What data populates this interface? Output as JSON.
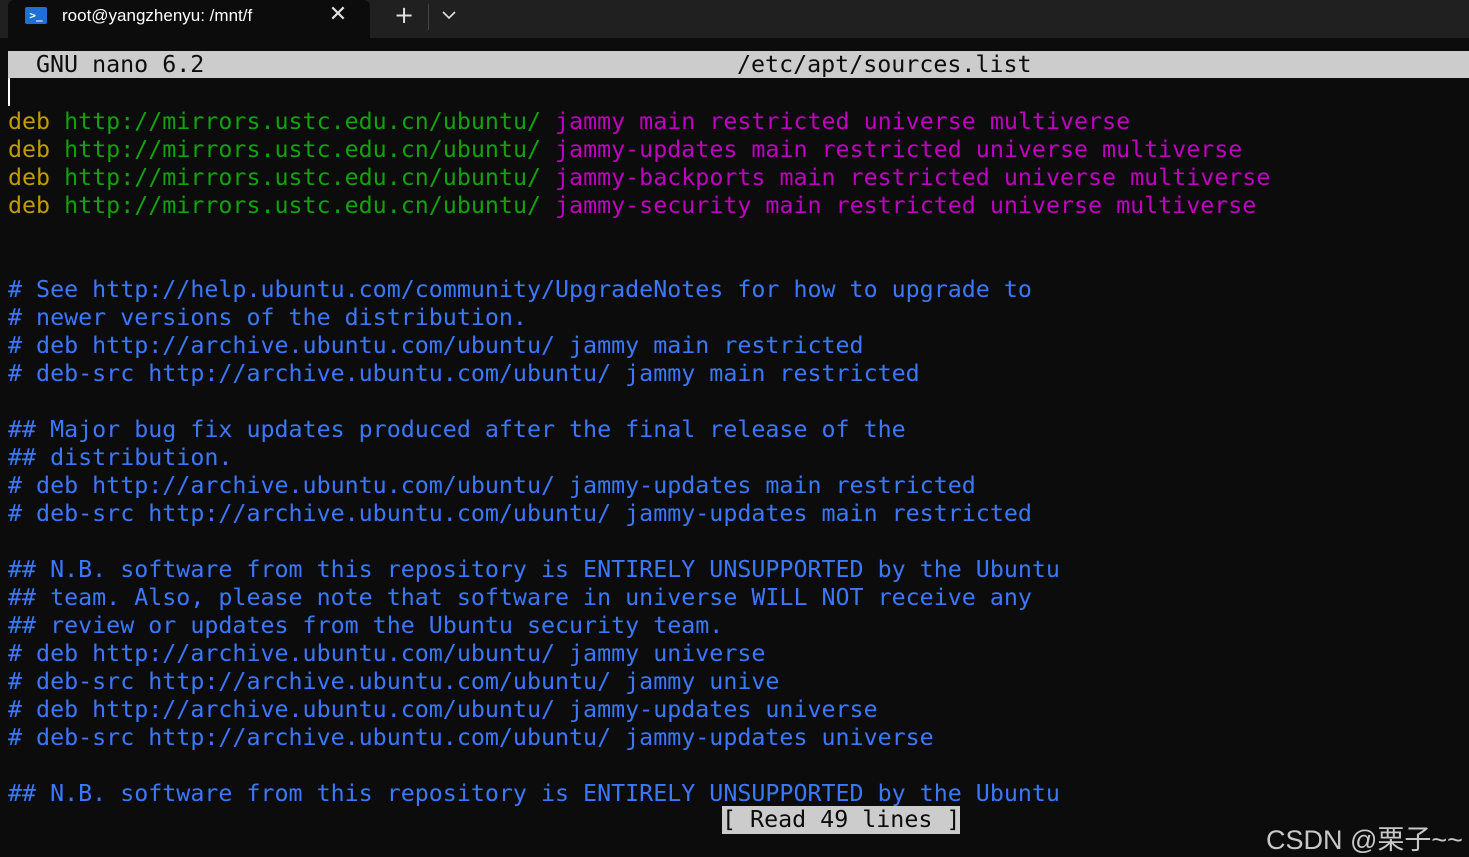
{
  "tab": {
    "title": "root@yangzhenyu: /mnt/f",
    "icon_glyph": ">_",
    "icon": "powershell-icon",
    "close_glyph": "✕",
    "new_tab_glyph": "+"
  },
  "nano": {
    "version_label": "GNU nano 6.2",
    "filename": "/etc/apt/sources.list",
    "status": "[ Read 49 lines ]"
  },
  "deb_lines": [
    {
      "keyword": "deb",
      "url": "http://mirrors.ustc.edu.cn/ubuntu/",
      "dist": "jammy main restricted universe multiverse"
    },
    {
      "keyword": "deb",
      "url": "http://mirrors.ustc.edu.cn/ubuntu/",
      "dist": "jammy-updates main restricted universe multiverse"
    },
    {
      "keyword": "deb",
      "url": "http://mirrors.ustc.edu.cn/ubuntu/",
      "dist": "jammy-backports main restricted universe multiverse"
    },
    {
      "keyword": "deb",
      "url": "http://mirrors.ustc.edu.cn/ubuntu/",
      "dist": "jammy-security main restricted universe multiverse"
    }
  ],
  "comment_lines": [
    "# See http://help.ubuntu.com/community/UpgradeNotes for how to upgrade to",
    "# newer versions of the distribution.",
    "# deb http://archive.ubuntu.com/ubuntu/ jammy main restricted",
    "# deb-src http://archive.ubuntu.com/ubuntu/ jammy main restricted",
    "",
    "## Major bug fix updates produced after the final release of the",
    "## distribution.",
    "# deb http://archive.ubuntu.com/ubuntu/ jammy-updates main restricted",
    "# deb-src http://archive.ubuntu.com/ubuntu/ jammy-updates main restricted",
    "",
    "## N.B. software from this repository is ENTIRELY UNSUPPORTED by the Ubuntu",
    "## team. Also, please note that software in universe WILL NOT receive any",
    "## review or updates from the Ubuntu security team.",
    "# deb http://archive.ubuntu.com/ubuntu/ jammy universe",
    "# deb-src http://archive.ubuntu.com/ubuntu/ jammy unive",
    "# deb http://archive.ubuntu.com/ubuntu/ jammy-updates universe",
    "# deb-src http://archive.ubuntu.com/ubuntu/ jammy-updates universe",
    "",
    "## N.B. software from this repository is ENTIRELY UNSUPPORTED by the Ubuntu"
  ],
  "watermark": "CSDN @栗子~~",
  "colors": {
    "background": "#0c0c0c",
    "keyword": "#c19c00",
    "url": "#13a10e",
    "dist": "#c000c0",
    "comment": "#3b78ff",
    "header_bg": "#cccccc"
  }
}
